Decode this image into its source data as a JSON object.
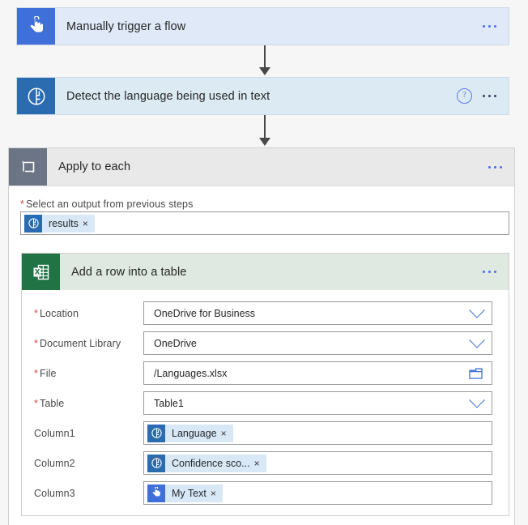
{
  "flow": {
    "trigger": {
      "title": "Manually trigger a flow",
      "icon": "touch-trigger-icon",
      "icon_color": "#3f6fd8",
      "background": "#dfe9f8",
      "menu_label": "..."
    },
    "action": {
      "title": "Detect the language being used in text",
      "icon": "cognitive-brain-icon",
      "icon_color": "#2b6cb0",
      "background": "#dceaf4",
      "help_label": "?",
      "menu_label": "..."
    },
    "loop": {
      "title": "Apply to each",
      "icon": "loop-icon",
      "icon_color": "#6b7585",
      "menu_label": "...",
      "output_field": {
        "label": "Select an output from previous steps",
        "required": true,
        "token": {
          "text": "results",
          "icon": "cognitive-brain-icon",
          "remove_label": "×"
        }
      },
      "excel_action": {
        "title": "Add a row into a table",
        "icon": "excel-icon",
        "icon_color": "#217346",
        "background": "#dfe9e1",
        "menu_label": "...",
        "fields": [
          {
            "label": "Location",
            "required": true,
            "value": "OneDrive for Business",
            "control": "dropdown"
          },
          {
            "label": "Document Library",
            "required": true,
            "value": "OneDrive",
            "control": "dropdown"
          },
          {
            "label": "File",
            "required": true,
            "value": "/Languages.xlsx",
            "control": "file-picker"
          },
          {
            "label": "Table",
            "required": true,
            "value": "Table1",
            "control": "dropdown"
          },
          {
            "label": "Column1",
            "required": false,
            "control": "token",
            "token": {
              "text": "Language",
              "icon": "cognitive-brain-icon",
              "icon_color": "#2b6cb0",
              "remove_label": "×"
            }
          },
          {
            "label": "Column2",
            "required": false,
            "control": "token",
            "token": {
              "text": "Confidence sco...",
              "icon": "cognitive-brain-icon",
              "icon_color": "#2b6cb0",
              "remove_label": "×"
            }
          },
          {
            "label": "Column3",
            "required": false,
            "control": "token",
            "token": {
              "text": "My Text",
              "icon": "touch-trigger-icon",
              "icon_color": "#3f6fd8",
              "remove_label": "×"
            }
          }
        ]
      }
    }
  },
  "colors": {
    "trigger_blue": "#3f6fd8",
    "cognitive_blue": "#2b6cb0",
    "loop_slate": "#6b7585",
    "excel_green": "#217346",
    "chip_bg": "#d9e8f7",
    "required_red": "#d64545",
    "accent_link": "#4f6bed"
  }
}
